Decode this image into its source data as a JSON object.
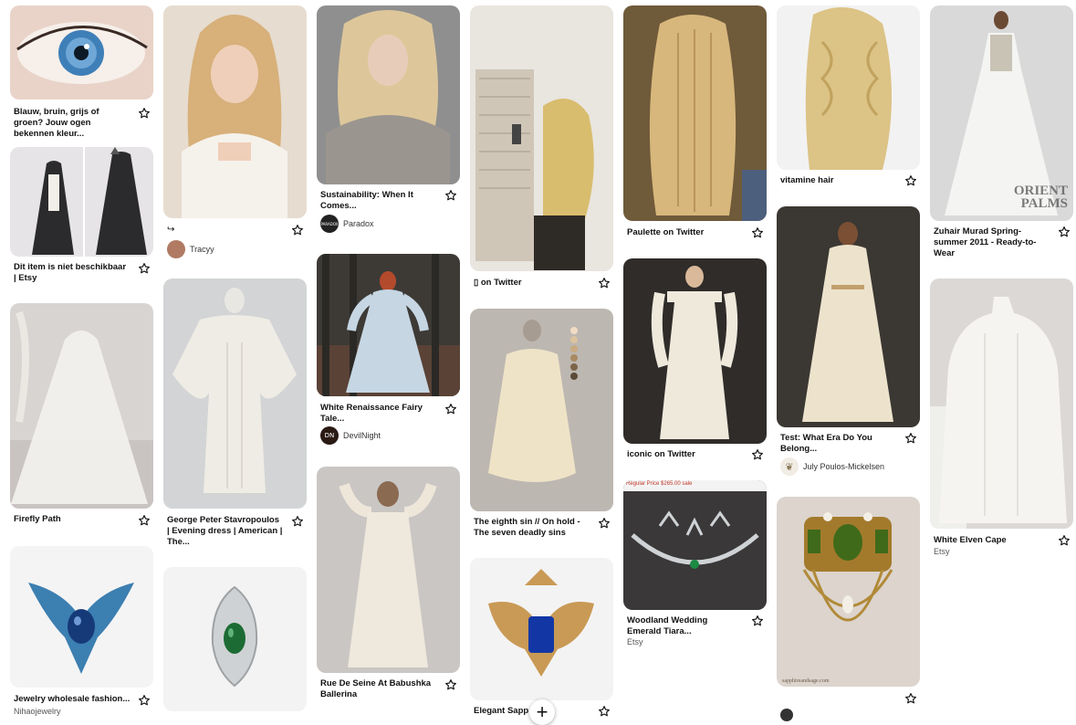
{
  "pins": {
    "c1_1": {
      "title": "Blauw, bruin, grijs of groen? Jouw ogen bekennen kleur..."
    },
    "c1_2": {
      "title": "Dit item is niet beschikbaar | Etsy"
    },
    "c1_3": {
      "title": "Firefly Path"
    },
    "c1_4": {
      "title": "Jewelry wholesale fashion...",
      "sub": "Nihaojewelry"
    },
    "c2_1": {
      "title": "",
      "author": "Tracyy",
      "glyph": "↪"
    },
    "c2_2": {
      "title": "George Peter Stavropoulos | Evening dress | American | The..."
    },
    "c3_1": {
      "title": "Sustainability: When It Comes...",
      "author": "Paradox",
      "avatar": "PARADOX"
    },
    "c3_2": {
      "title": "White Renaissance Fairy Tale...",
      "author": "DevilNight",
      "avatar": "DN"
    },
    "c3_3": {
      "title": "Rue De Seine At Babushka Ballerina"
    },
    "c4_1": {
      "title": "▯ on Twitter"
    },
    "c4_2": {
      "title": "The eighth sin // On hold - The seven deadly sins"
    },
    "c4_3": {
      "title": "Elegant Sapp   ble"
    },
    "c5_1": {
      "title": "Paulette on Twitter"
    },
    "c5_2": {
      "title": "iconic on Twitter"
    },
    "c5_3": {
      "title": "Woodland Wedding Emerald Tiara...",
      "sub": "Etsy",
      "banner": "Regular Price $265.00 sale"
    },
    "c6_1": {
      "title": "vitamine hair"
    },
    "c6_2": {
      "title": "Test: What Era Do You Belong...",
      "author": "July Poulos-Mickelsen"
    },
    "c6_3": {
      "title": "",
      "watermark": "sapphireandsage.com"
    },
    "c7_1": {
      "title": "Zuhair Murad Spring-summer 2011 - Ready-to-Wear",
      "watermark": "ORIENT PALMS"
    },
    "c7_2": {
      "title": "White Elven Cape",
      "sub": "Etsy"
    }
  },
  "fab": {
    "label": "+"
  },
  "colors": {
    "text": "#111111",
    "sub": "#555555",
    "background": "#ffffff"
  },
  "icons": {
    "save": "star-outline-icon",
    "create": "plus-icon"
  }
}
